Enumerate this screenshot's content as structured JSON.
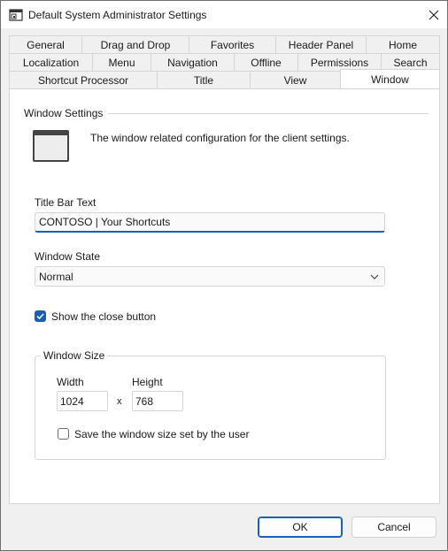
{
  "window": {
    "title": "Default System Administrator Settings"
  },
  "tabs": {
    "row1": [
      "General",
      "Drag and Drop",
      "Favorites",
      "Header Panel",
      "Home"
    ],
    "row2": [
      "Localization",
      "Menu",
      "Navigation",
      "Offline",
      "Permissions",
      "Search"
    ],
    "row3": [
      "Shortcut Processor",
      "Title",
      "View",
      "Window"
    ],
    "active": "Window"
  },
  "panel": {
    "section_title": "Window Settings",
    "description": "The window related configuration for the client settings.",
    "title_bar_label": "Title Bar Text",
    "title_bar_value": "CONTOSO | Your Shortcuts",
    "window_state_label": "Window State",
    "window_state_value": "Normal",
    "show_close_label": "Show the close button",
    "show_close_checked": true,
    "size_group_title": "Window Size",
    "width_label": "Width",
    "width_value": "1024",
    "times": "x",
    "height_label": "Height",
    "height_value": "768",
    "save_size_label": "Save the window size set by the user",
    "save_size_checked": false
  },
  "buttons": {
    "ok": "OK",
    "cancel": "Cancel"
  },
  "colors": {
    "accent": "#1a5fb4"
  }
}
